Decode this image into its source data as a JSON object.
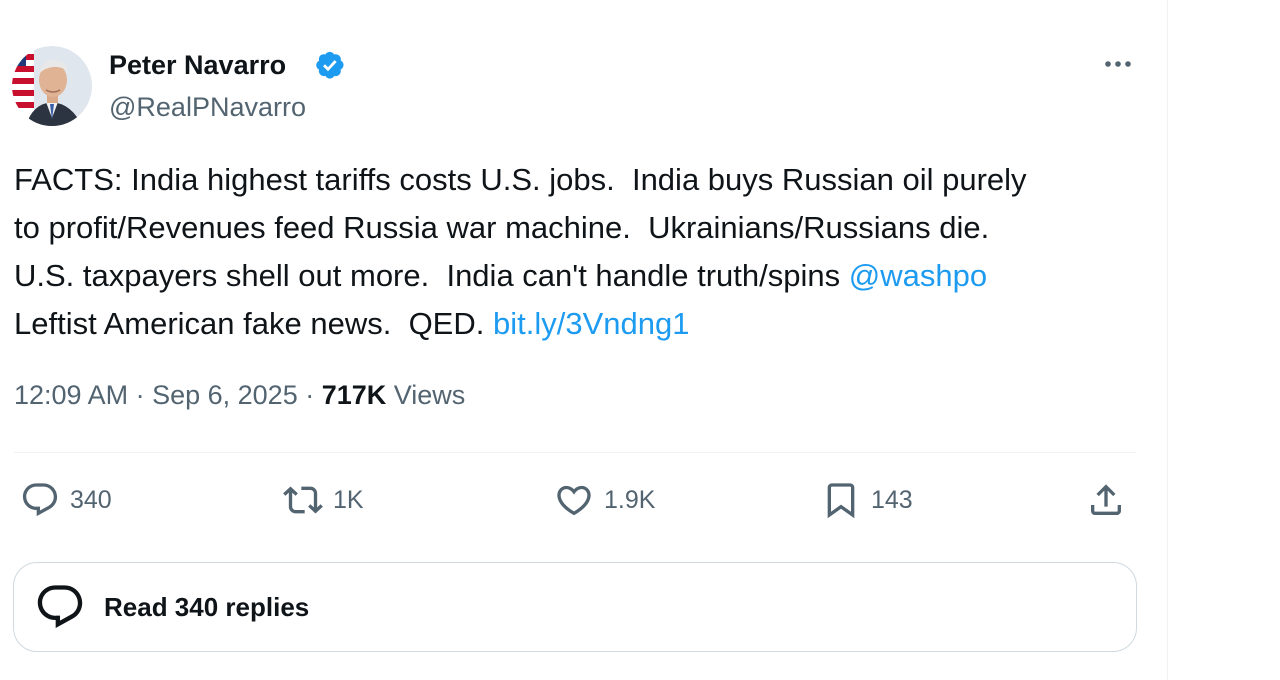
{
  "author": {
    "name": "Peter Navarro",
    "handle": "@RealPNavarro"
  },
  "tweet": {
    "lines": [
      [
        "FACTS: India highest tariffs costs U.S. jobs.  India buys Russian oil purely"
      ],
      [
        "to profit/Revenues feed Russia war machine.  Ukrainians/Russians die."
      ],
      [
        "U.S. taxpayers shell out more.  India can't handle truth/spins ",
        "@washpo"
      ],
      [
        "Leftist American fake news.  QED. ",
        "bit.ly/3Vndng1"
      ]
    ],
    "mention": "@washpo",
    "link": "bit.ly/3Vndng1"
  },
  "meta": {
    "time": "12:09 AM",
    "separator": " · ",
    "date": "Sep 6, 2025",
    "views_count": "717K",
    "views_label": " Views"
  },
  "actions": {
    "replies": "340",
    "reposts": "1K",
    "likes": "1.9K",
    "bookmarks": "143"
  },
  "read_replies": {
    "label": "Read 340 replies"
  },
  "icons": {
    "verified": "verified-badge-icon",
    "more": "more-dots-icon",
    "reply": "reply-bubble-icon",
    "repost": "repost-icon",
    "like": "heart-icon",
    "bookmark": "bookmark-icon",
    "share": "share-icon",
    "conversation": "conversation-icon"
  },
  "colors": {
    "link": "#1d9bf0",
    "secondary_text": "#536471",
    "primary_text": "#0f1419",
    "verified": "#1d9bf0"
  }
}
